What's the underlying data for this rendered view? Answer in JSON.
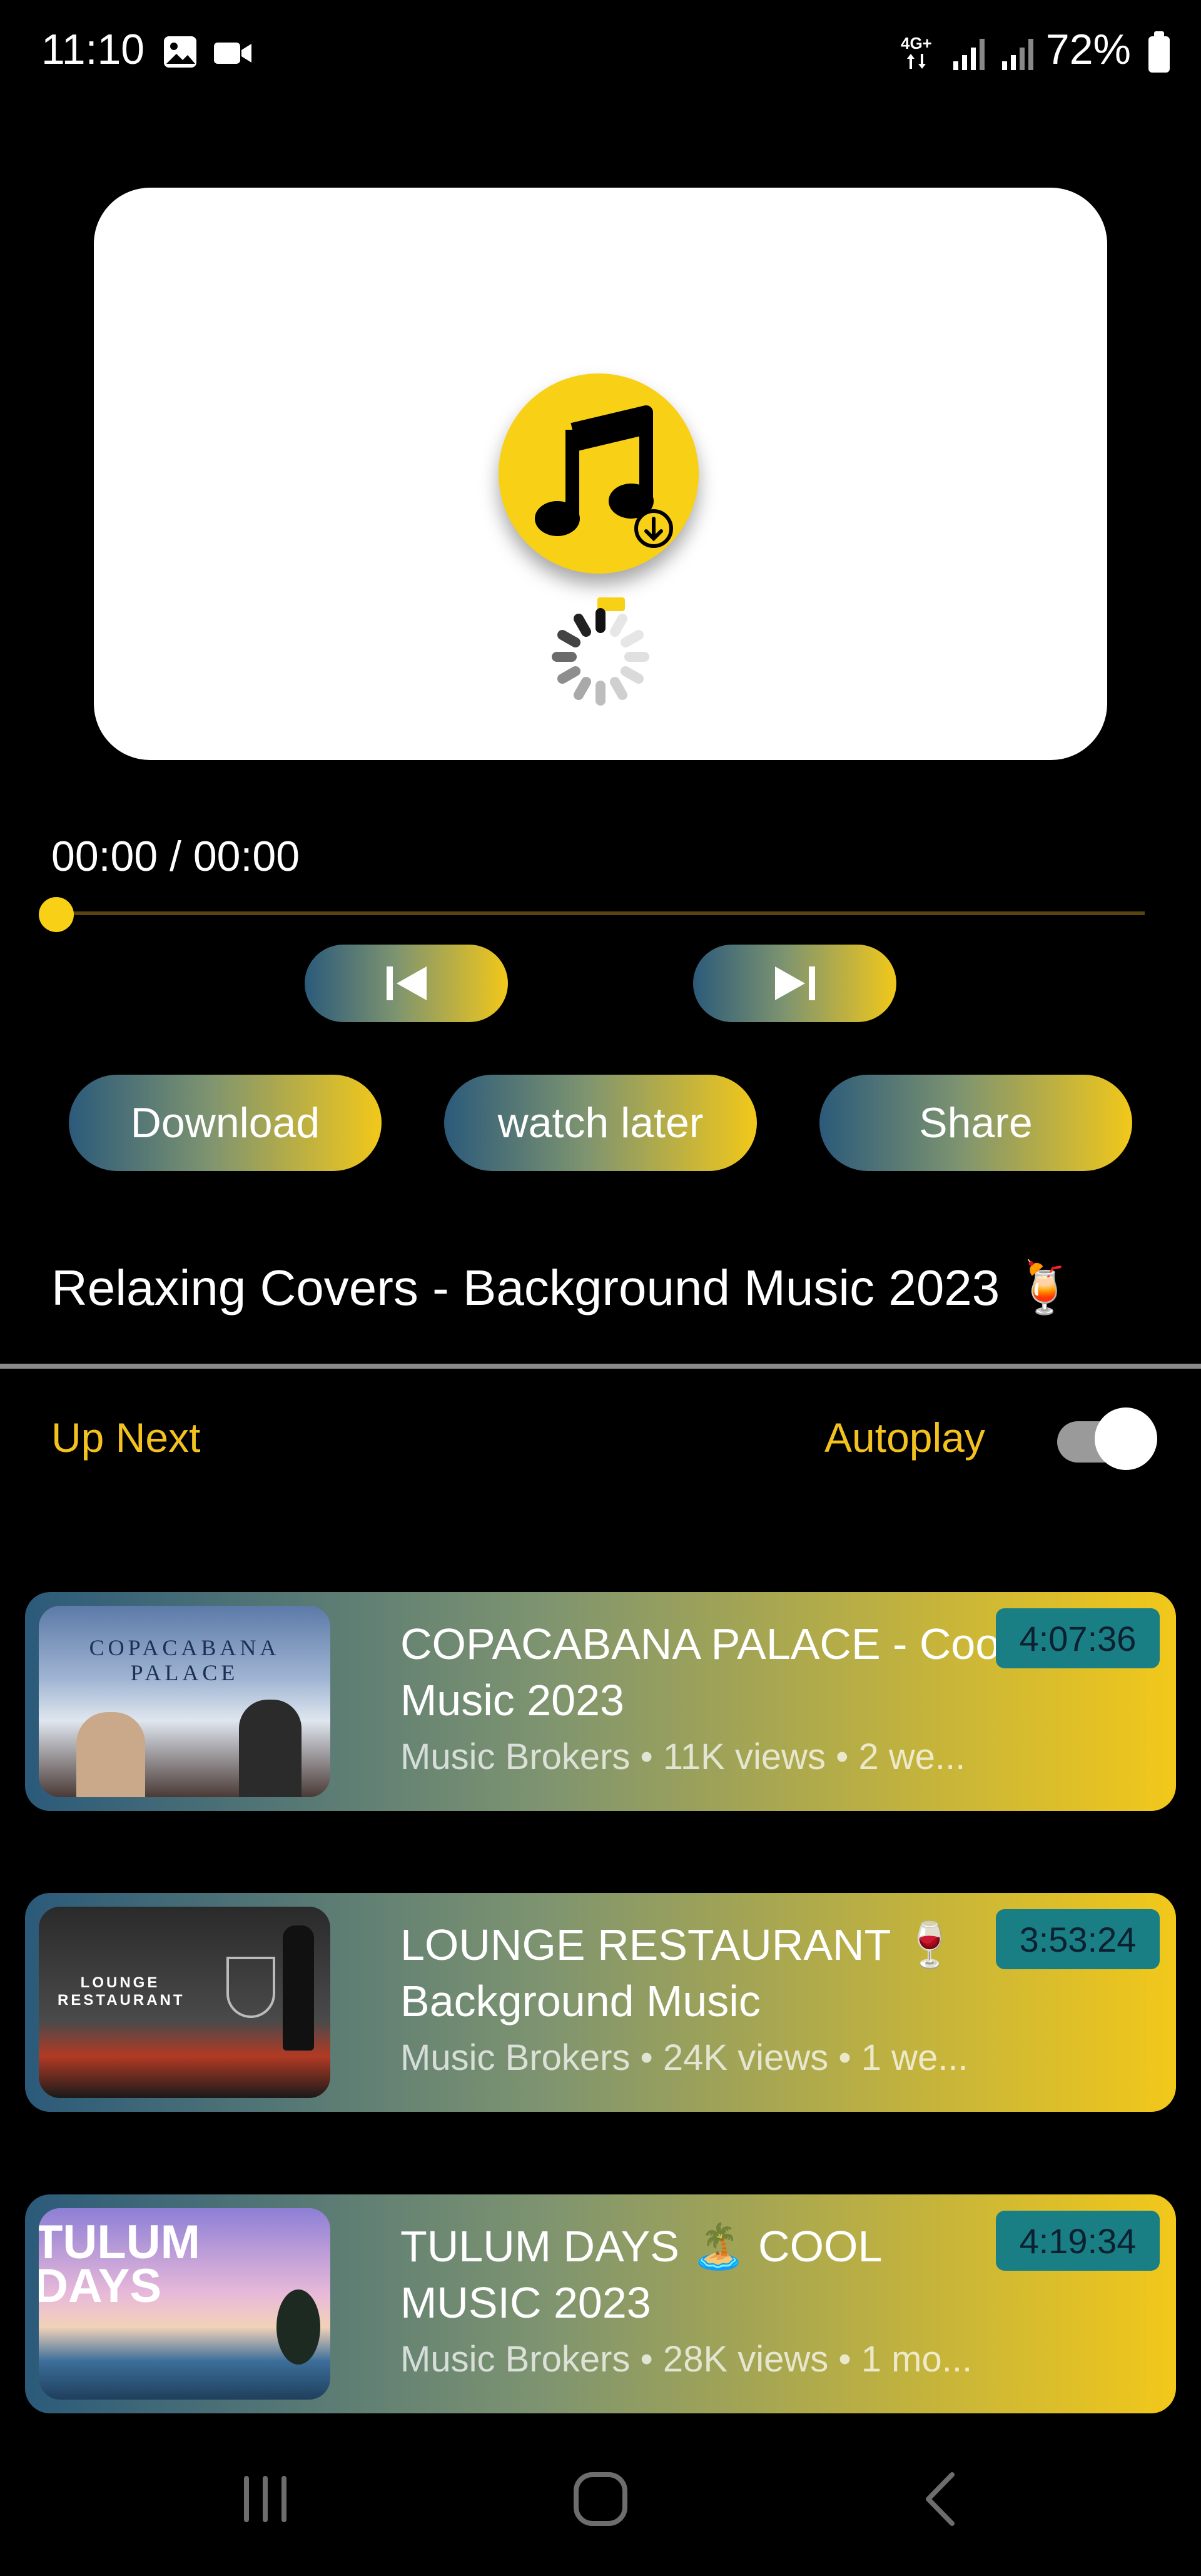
{
  "status_bar": {
    "time": "11:10",
    "battery": "72%",
    "network": "4G+",
    "icons": [
      "gallery-icon",
      "video-camera-icon",
      "signal-icon",
      "battery-icon"
    ]
  },
  "player": {
    "icon": "music-note-download-icon",
    "loading": true,
    "timecode": "00:00 / 00:00",
    "progress": 0
  },
  "controls": {
    "previous_icon": "skip-previous-icon",
    "next_icon": "skip-next-icon"
  },
  "actions": {
    "download": "Download",
    "watch_later": "watch later",
    "share": "Share"
  },
  "now_playing": {
    "title": "Relaxing Covers - Background Music 2023 🍹"
  },
  "up_next": {
    "label": "Up Next",
    "autoplay_label": "Autoplay",
    "autoplay_on": true
  },
  "playlist": [
    {
      "title": "COPACABANA PALACE - Cool Music 2023",
      "meta": "Music Brokers • 11K views • 2 we...",
      "duration": "4:07:36",
      "thumb_text": [
        "COPACABANA",
        "PALACE"
      ]
    },
    {
      "title": "LOUNGE RESTAURANT 🍷 Background Music",
      "meta": "Music Brokers • 24K views • 1 we...",
      "duration": "3:53:24",
      "thumb_text": [
        "LOUNGE",
        "RESTAURANT"
      ]
    },
    {
      "title": "TULUM DAYS 🏝️ COOL MUSIC 2023",
      "meta": "Music Brokers • 28K views • 1 mo...",
      "duration": "4:19:34",
      "thumb_text": [
        "TULUM",
        "DAYS"
      ]
    }
  ],
  "colors": {
    "accent": "#F8D015",
    "gradient_start": "#2B5A7A",
    "gradient_end": "#F2C81A",
    "duration_badge": "#1A7F84",
    "label_yellow": "#F4C21F"
  }
}
